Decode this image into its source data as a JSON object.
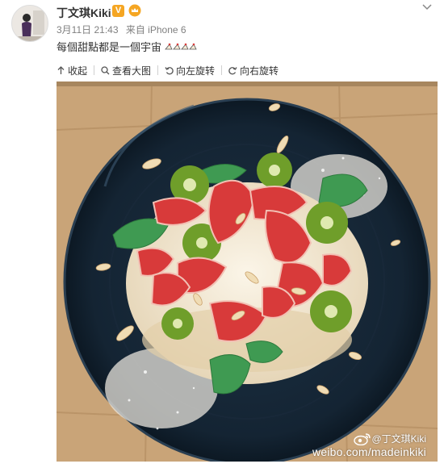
{
  "post": {
    "author": "丁文琪Kiki",
    "date": "3月11日 21:43",
    "source": "来自 iPhone 6",
    "text": "每個甜點都是一個宇宙"
  },
  "toolbar": {
    "collapse": "收起",
    "view_large": "查看大图",
    "rotate_left": "向左旋转",
    "rotate_right": "向右旋转"
  },
  "watermark": {
    "handle": "@丁文琪Kiki",
    "url": "weibo.com/madeinkiki"
  },
  "colors": {
    "plate": "#142433",
    "table": "#c9a478",
    "strawberry": "#d83a3a",
    "kiwi": "#6f9e2a",
    "mint": "#3f9a52",
    "cream": "#f4ead6",
    "badge": "#f5a623"
  }
}
